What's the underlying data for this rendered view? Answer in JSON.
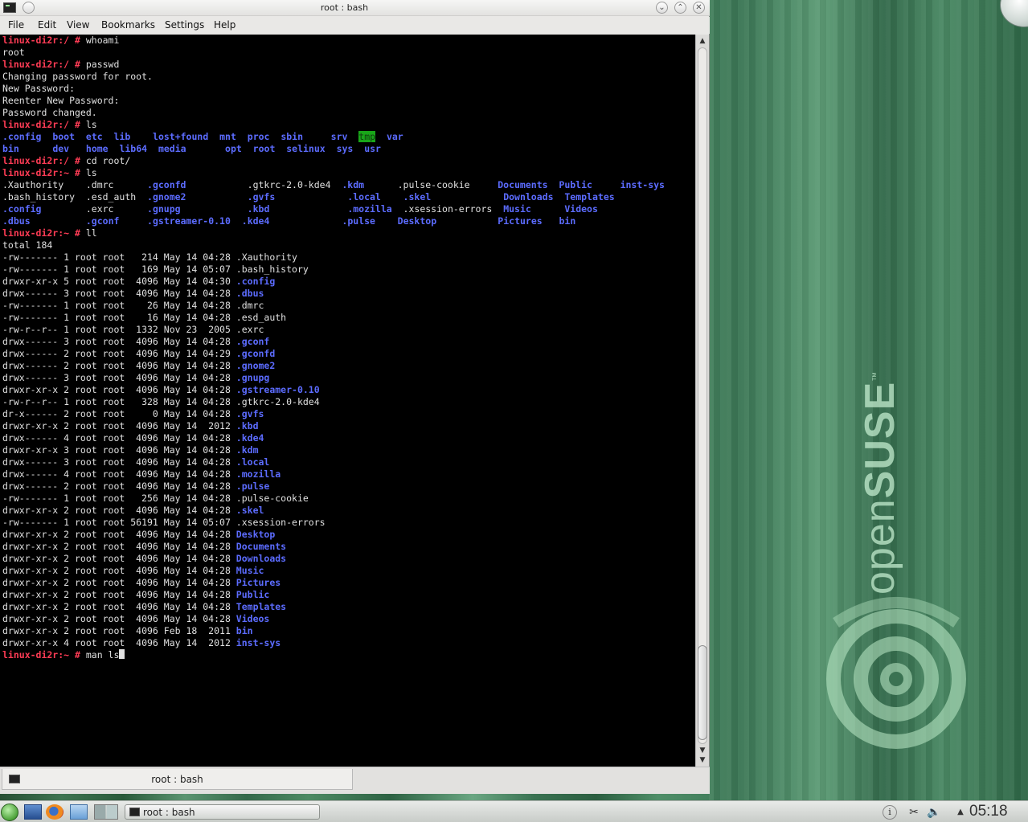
{
  "window": {
    "title": "root : bash"
  },
  "menu": [
    "File",
    "Edit",
    "View",
    "Bookmarks",
    "Settings",
    "Help"
  ],
  "terminal": {
    "lines": [
      [
        [
          "linux-di2r:/ # ",
          "pr"
        ],
        [
          "whoami",
          ""
        ]
      ],
      [
        [
          "root",
          ""
        ]
      ],
      [
        [
          "linux-di2r:/ # ",
          "pr"
        ],
        [
          "passwd",
          ""
        ]
      ],
      [
        [
          "Changing password for root.",
          ""
        ]
      ],
      [
        [
          "New Password:",
          ""
        ]
      ],
      [
        [
          "Reenter New Password:",
          ""
        ]
      ],
      [
        [
          "Password changed.",
          ""
        ]
      ],
      [
        [
          "linux-di2r:/ # ",
          "pr"
        ],
        [
          "ls",
          ""
        ]
      ],
      [
        [
          ".config",
          "dir"
        ],
        [
          "  ",
          ""
        ],
        [
          "boot",
          "dir"
        ],
        [
          "  ",
          ""
        ],
        [
          "etc",
          "dir"
        ],
        [
          "  ",
          ""
        ],
        [
          "lib",
          "dir"
        ],
        [
          "    ",
          ""
        ],
        [
          "lost+found",
          "dir"
        ],
        [
          "  ",
          ""
        ],
        [
          "mnt",
          "dir"
        ],
        [
          "  ",
          ""
        ],
        [
          "proc",
          "dir"
        ],
        [
          "  ",
          ""
        ],
        [
          "sbin",
          "dir"
        ],
        [
          "     ",
          ""
        ],
        [
          "srv",
          "dir"
        ],
        [
          "  ",
          ""
        ],
        [
          "tmp",
          "hl"
        ],
        [
          "  ",
          ""
        ],
        [
          "var",
          "dir"
        ]
      ],
      [
        [
          "bin",
          "dir"
        ],
        [
          "      ",
          ""
        ],
        [
          "dev",
          "dir"
        ],
        [
          "   ",
          ""
        ],
        [
          "home",
          "dir"
        ],
        [
          "  ",
          ""
        ],
        [
          "lib64",
          "dir"
        ],
        [
          "  ",
          ""
        ],
        [
          "media",
          "dir"
        ],
        [
          "       ",
          ""
        ],
        [
          "opt",
          "dir"
        ],
        [
          "  ",
          ""
        ],
        [
          "root",
          "dir"
        ],
        [
          "  ",
          ""
        ],
        [
          "selinux",
          "dir"
        ],
        [
          "  ",
          ""
        ],
        [
          "sys",
          "dir"
        ],
        [
          "  ",
          ""
        ],
        [
          "usr",
          "dir"
        ]
      ],
      [
        [
          "linux-di2r:/ # ",
          "pr"
        ],
        [
          "cd root/",
          ""
        ]
      ],
      [
        [
          "linux-di2r:~ # ",
          "pr"
        ],
        [
          "ls",
          ""
        ]
      ],
      [
        [
          ".Xauthority    .dmrc      ",
          ""
        ],
        [
          ".gconfd",
          "dir"
        ],
        [
          "           .gtkrc-2.0-kde4  ",
          ""
        ],
        [
          ".kdm",
          "dir"
        ],
        [
          "      .pulse-cookie     ",
          ""
        ],
        [
          "Documents",
          "dir"
        ],
        [
          "  ",
          ""
        ],
        [
          "Public",
          "dir"
        ],
        [
          "     ",
          ""
        ],
        [
          "inst-sys",
          "dir"
        ]
      ],
      [
        [
          ".bash_history  .esd_auth  ",
          ""
        ],
        [
          ".gnome2",
          "dir"
        ],
        [
          "           ",
          ""
        ],
        [
          ".gvfs",
          "dir"
        ],
        [
          "             ",
          ""
        ],
        [
          ".local",
          "dir"
        ],
        [
          "    ",
          ""
        ],
        [
          ".skel",
          "dir"
        ],
        [
          "             ",
          ""
        ],
        [
          "Downloads",
          "dir"
        ],
        [
          "  ",
          ""
        ],
        [
          "Templates",
          "dir"
        ]
      ],
      [
        [
          ".config",
          "dir"
        ],
        [
          "        .exrc      ",
          ""
        ],
        [
          ".gnupg",
          "dir"
        ],
        [
          "            ",
          ""
        ],
        [
          ".kbd",
          "dir"
        ],
        [
          "              ",
          ""
        ],
        [
          ".mozilla",
          "dir"
        ],
        [
          "  .xsession-errors  ",
          ""
        ],
        [
          "Music",
          "dir"
        ],
        [
          "      ",
          ""
        ],
        [
          "Videos",
          "dir"
        ]
      ],
      [
        [
          ".dbus",
          "dir"
        ],
        [
          "          ",
          ""
        ],
        [
          ".gconf",
          "dir"
        ],
        [
          "     ",
          ""
        ],
        [
          ".gstreamer-0.10",
          "dir"
        ],
        [
          "  ",
          ""
        ],
        [
          ".kde4",
          "dir"
        ],
        [
          "             ",
          ""
        ],
        [
          ".pulse",
          "dir"
        ],
        [
          "    ",
          ""
        ],
        [
          "Desktop",
          "dir"
        ],
        [
          "           ",
          ""
        ],
        [
          "Pictures",
          "dir"
        ],
        [
          "   ",
          ""
        ],
        [
          "bin",
          "dir"
        ]
      ],
      [
        [
          "linux-di2r:~ # ",
          "pr"
        ],
        [
          "ll",
          ""
        ]
      ],
      [
        [
          "total 184",
          ""
        ]
      ],
      [
        [
          "-rw------- 1 root root   214 May 14 04:28 .Xauthority",
          ""
        ]
      ],
      [
        [
          "-rw------- 1 root root   169 May 14 05:07 .bash_history",
          ""
        ]
      ],
      [
        [
          "drwxr-xr-x 5 root root  4096 May 14 04:30 ",
          ""
        ],
        [
          ".config",
          "dir"
        ]
      ],
      [
        [
          "drwx------ 3 root root  4096 May 14 04:28 ",
          ""
        ],
        [
          ".dbus",
          "dir"
        ]
      ],
      [
        [
          "-rw------- 1 root root    26 May 14 04:28 .dmrc",
          ""
        ]
      ],
      [
        [
          "-rw------- 1 root root    16 May 14 04:28 .esd_auth",
          ""
        ]
      ],
      [
        [
          "-rw-r--r-- 1 root root  1332 Nov 23  2005 .exrc",
          ""
        ]
      ],
      [
        [
          "drwx------ 3 root root  4096 May 14 04:28 ",
          ""
        ],
        [
          ".gconf",
          "dir"
        ]
      ],
      [
        [
          "drwx------ 2 root root  4096 May 14 04:29 ",
          ""
        ],
        [
          ".gconfd",
          "dir"
        ]
      ],
      [
        [
          "drwx------ 2 root root  4096 May 14 04:28 ",
          ""
        ],
        [
          ".gnome2",
          "dir"
        ]
      ],
      [
        [
          "drwx------ 3 root root  4096 May 14 04:28 ",
          ""
        ],
        [
          ".gnupg",
          "dir"
        ]
      ],
      [
        [
          "drwxr-xr-x 2 root root  4096 May 14 04:28 ",
          ""
        ],
        [
          ".gstreamer-0.10",
          "dir"
        ]
      ],
      [
        [
          "-rw-r--r-- 1 root root   328 May 14 04:28 .gtkrc-2.0-kde4",
          ""
        ]
      ],
      [
        [
          "dr-x------ 2 root root     0 May 14 04:28 ",
          ""
        ],
        [
          ".gvfs",
          "dir"
        ]
      ],
      [
        [
          "drwxr-xr-x 2 root root  4096 May 14  2012 ",
          ""
        ],
        [
          ".kbd",
          "dir"
        ]
      ],
      [
        [
          "drwx------ 4 root root  4096 May 14 04:28 ",
          ""
        ],
        [
          ".kde4",
          "dir"
        ]
      ],
      [
        [
          "drwxr-xr-x 3 root root  4096 May 14 04:28 ",
          ""
        ],
        [
          ".kdm",
          "dir"
        ]
      ],
      [
        [
          "drwx------ 3 root root  4096 May 14 04:28 ",
          ""
        ],
        [
          ".local",
          "dir"
        ]
      ],
      [
        [
          "drwx------ 4 root root  4096 May 14 04:28 ",
          ""
        ],
        [
          ".mozilla",
          "dir"
        ]
      ],
      [
        [
          "drwx------ 2 root root  4096 May 14 04:28 ",
          ""
        ],
        [
          ".pulse",
          "dir"
        ]
      ],
      [
        [
          "-rw------- 1 root root   256 May 14 04:28 .pulse-cookie",
          ""
        ]
      ],
      [
        [
          "drwxr-xr-x 2 root root  4096 May 14 04:28 ",
          ""
        ],
        [
          ".skel",
          "dir"
        ]
      ],
      [
        [
          "-rw------- 1 root root 56191 May 14 05:07 .xsession-errors",
          ""
        ]
      ],
      [
        [
          "drwxr-xr-x 2 root root  4096 May 14 04:28 ",
          ""
        ],
        [
          "Desktop",
          "dir"
        ]
      ],
      [
        [
          "drwxr-xr-x 2 root root  4096 May 14 04:28 ",
          ""
        ],
        [
          "Documents",
          "dir"
        ]
      ],
      [
        [
          "drwxr-xr-x 2 root root  4096 May 14 04:28 ",
          ""
        ],
        [
          "Downloads",
          "dir"
        ]
      ],
      [
        [
          "drwxr-xr-x 2 root root  4096 May 14 04:28 ",
          ""
        ],
        [
          "Music",
          "dir"
        ]
      ],
      [
        [
          "drwxr-xr-x 2 root root  4096 May 14 04:28 ",
          ""
        ],
        [
          "Pictures",
          "dir"
        ]
      ],
      [
        [
          "drwxr-xr-x 2 root root  4096 May 14 04:28 ",
          ""
        ],
        [
          "Public",
          "dir"
        ]
      ],
      [
        [
          "drwxr-xr-x 2 root root  4096 May 14 04:28 ",
          ""
        ],
        [
          "Templates",
          "dir"
        ]
      ],
      [
        [
          "drwxr-xr-x 2 root root  4096 May 14 04:28 ",
          ""
        ],
        [
          "Videos",
          "dir"
        ]
      ],
      [
        [
          "drwxr-xr-x 2 root root  4096 Feb 18  2011 ",
          ""
        ],
        [
          "bin",
          "dir"
        ]
      ],
      [
        [
          "drwxr-xr-x 4 root root  4096 May 14  2012 ",
          ""
        ],
        [
          "inst-sys",
          "dir"
        ]
      ],
      [
        [
          "linux-di2r:~ # ",
          "pr"
        ],
        [
          "man ls",
          ""
        ],
        [
          "",
          "cursor"
        ]
      ]
    ]
  },
  "tab": {
    "label": "root : bash"
  },
  "taskbar": {
    "task_label": "root : bash",
    "clock": "05:18"
  },
  "wallpaper": {
    "brand_light": "open",
    "brand_bold": "SUSE",
    "tm": "™"
  },
  "icons": {
    "window": "terminal-icon",
    "shade": "chevron-down-icon",
    "maximize": "chevron-up-icon",
    "close": "close-icon",
    "launcher": "kde-menu-icon",
    "desktop": "show-desktop-icon",
    "browser": "firefox-icon",
    "files": "file-manager-icon",
    "pager": "pager-icon",
    "info": "info-icon",
    "clipboard": "scissors-icon",
    "volume": "speaker-icon",
    "tray_expand": "triangle-up-icon"
  },
  "colors": {
    "prompt": "#ff3c55",
    "directory": "#5c6cff",
    "highlight": "#19a619",
    "terminal_bg": "#000000",
    "terminal_fg": "#e0e0e0"
  }
}
